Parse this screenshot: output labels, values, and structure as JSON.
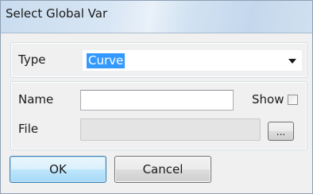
{
  "window": {
    "title": "Select Global Var"
  },
  "type_group": {
    "label": "Type",
    "selected_value": "Curve",
    "dropdown_icon": "chevron-down-icon"
  },
  "name_group": {
    "name_label": "Name",
    "name_value": "",
    "show_label": "Show",
    "show_checked": false,
    "file_label": "File",
    "file_value": "",
    "browse_label": "..."
  },
  "buttons": {
    "ok_label": "OK",
    "cancel_label": "Cancel"
  },
  "colors": {
    "selection_highlight": "#3399ff",
    "ok_button_border": "#3c7fb1",
    "dialog_background": "#f0f0f0"
  }
}
